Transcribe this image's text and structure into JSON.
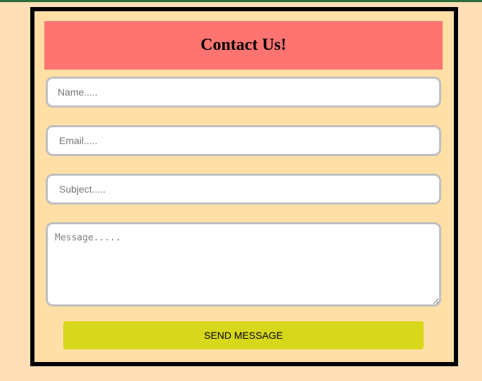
{
  "form": {
    "title": "Contact Us!",
    "fields": {
      "name": {
        "placeholder": "Name.....",
        "value": ""
      },
      "email": {
        "placeholder": "Email.....",
        "value": ""
      },
      "subject": {
        "placeholder": "Subject.....",
        "value": ""
      },
      "message": {
        "placeholder": "Message.....",
        "value": ""
      }
    },
    "submit_label": "SEND MESSAGE"
  },
  "colors": {
    "page_background": "#ffdfb8",
    "form_background": "#ffdfa6",
    "header_background": "#ff7470",
    "button_background": "#d7d71c",
    "form_border": "#000000",
    "field_border": "#bfbfbf"
  }
}
